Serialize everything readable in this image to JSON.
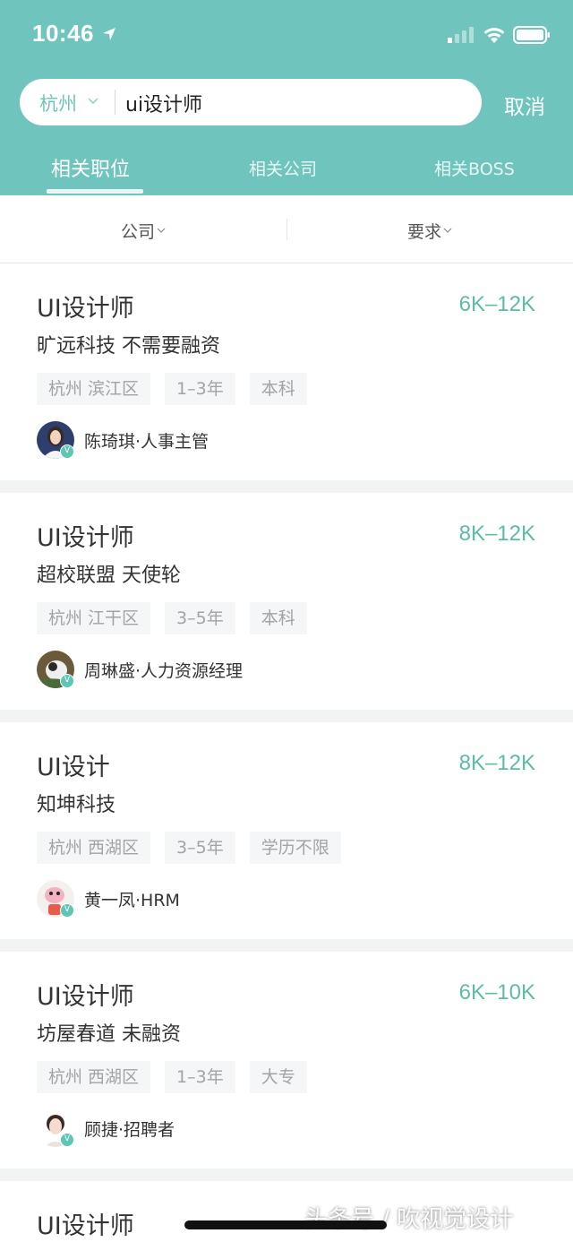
{
  "status_bar": {
    "time": "10:46",
    "location_icon": "location-arrow-icon",
    "signal_icon": "cellular-signal-icon",
    "wifi_icon": "wifi-icon",
    "battery_icon": "battery-icon"
  },
  "search": {
    "city": "杭州",
    "query": "ui设计师",
    "cancel_label": "取消"
  },
  "tabs": [
    {
      "label": "相关职位",
      "active": true
    },
    {
      "label": "相关公司",
      "active": false
    },
    {
      "label": "相关BOSS",
      "active": false
    }
  ],
  "filters": {
    "company_label": "公司",
    "requirement_label": "要求"
  },
  "jobs": [
    {
      "title": "UI设计师",
      "salary": "6K–12K",
      "company": "旷远科技 不需要融资",
      "tags": [
        "杭州 滨江区",
        "1–3年",
        "本科"
      ],
      "recruiter": "陈琦琪·人事主管"
    },
    {
      "title": "UI设计师",
      "salary": "8K–12K",
      "company": "超校联盟 天使轮",
      "tags": [
        "杭州 江干区",
        "3–5年",
        "本科"
      ],
      "recruiter": "周琳盛·人力资源经理"
    },
    {
      "title": "UI设计",
      "salary": "8K–12K",
      "company": "知坤科技",
      "tags": [
        "杭州 西湖区",
        "3–5年",
        "学历不限"
      ],
      "recruiter": "黄一凤·HRM"
    },
    {
      "title": "UI设计师",
      "salary": "6K–10K",
      "company": "坊屋春道 未融资",
      "tags": [
        "杭州 西湖区",
        "1–3年",
        "大专"
      ],
      "recruiter": "顾捷·招聘者"
    },
    {
      "title": "UI设计师",
      "salary": "",
      "company": "",
      "tags": [],
      "recruiter": ""
    }
  ],
  "watermark": "头条号 / 吹视觉设计",
  "colors": {
    "header_bg": "#6fc5bd",
    "accent": "#5fbba5",
    "verify_badge": "#5fc6b5",
    "tag_bg": "#f5f6f7"
  }
}
